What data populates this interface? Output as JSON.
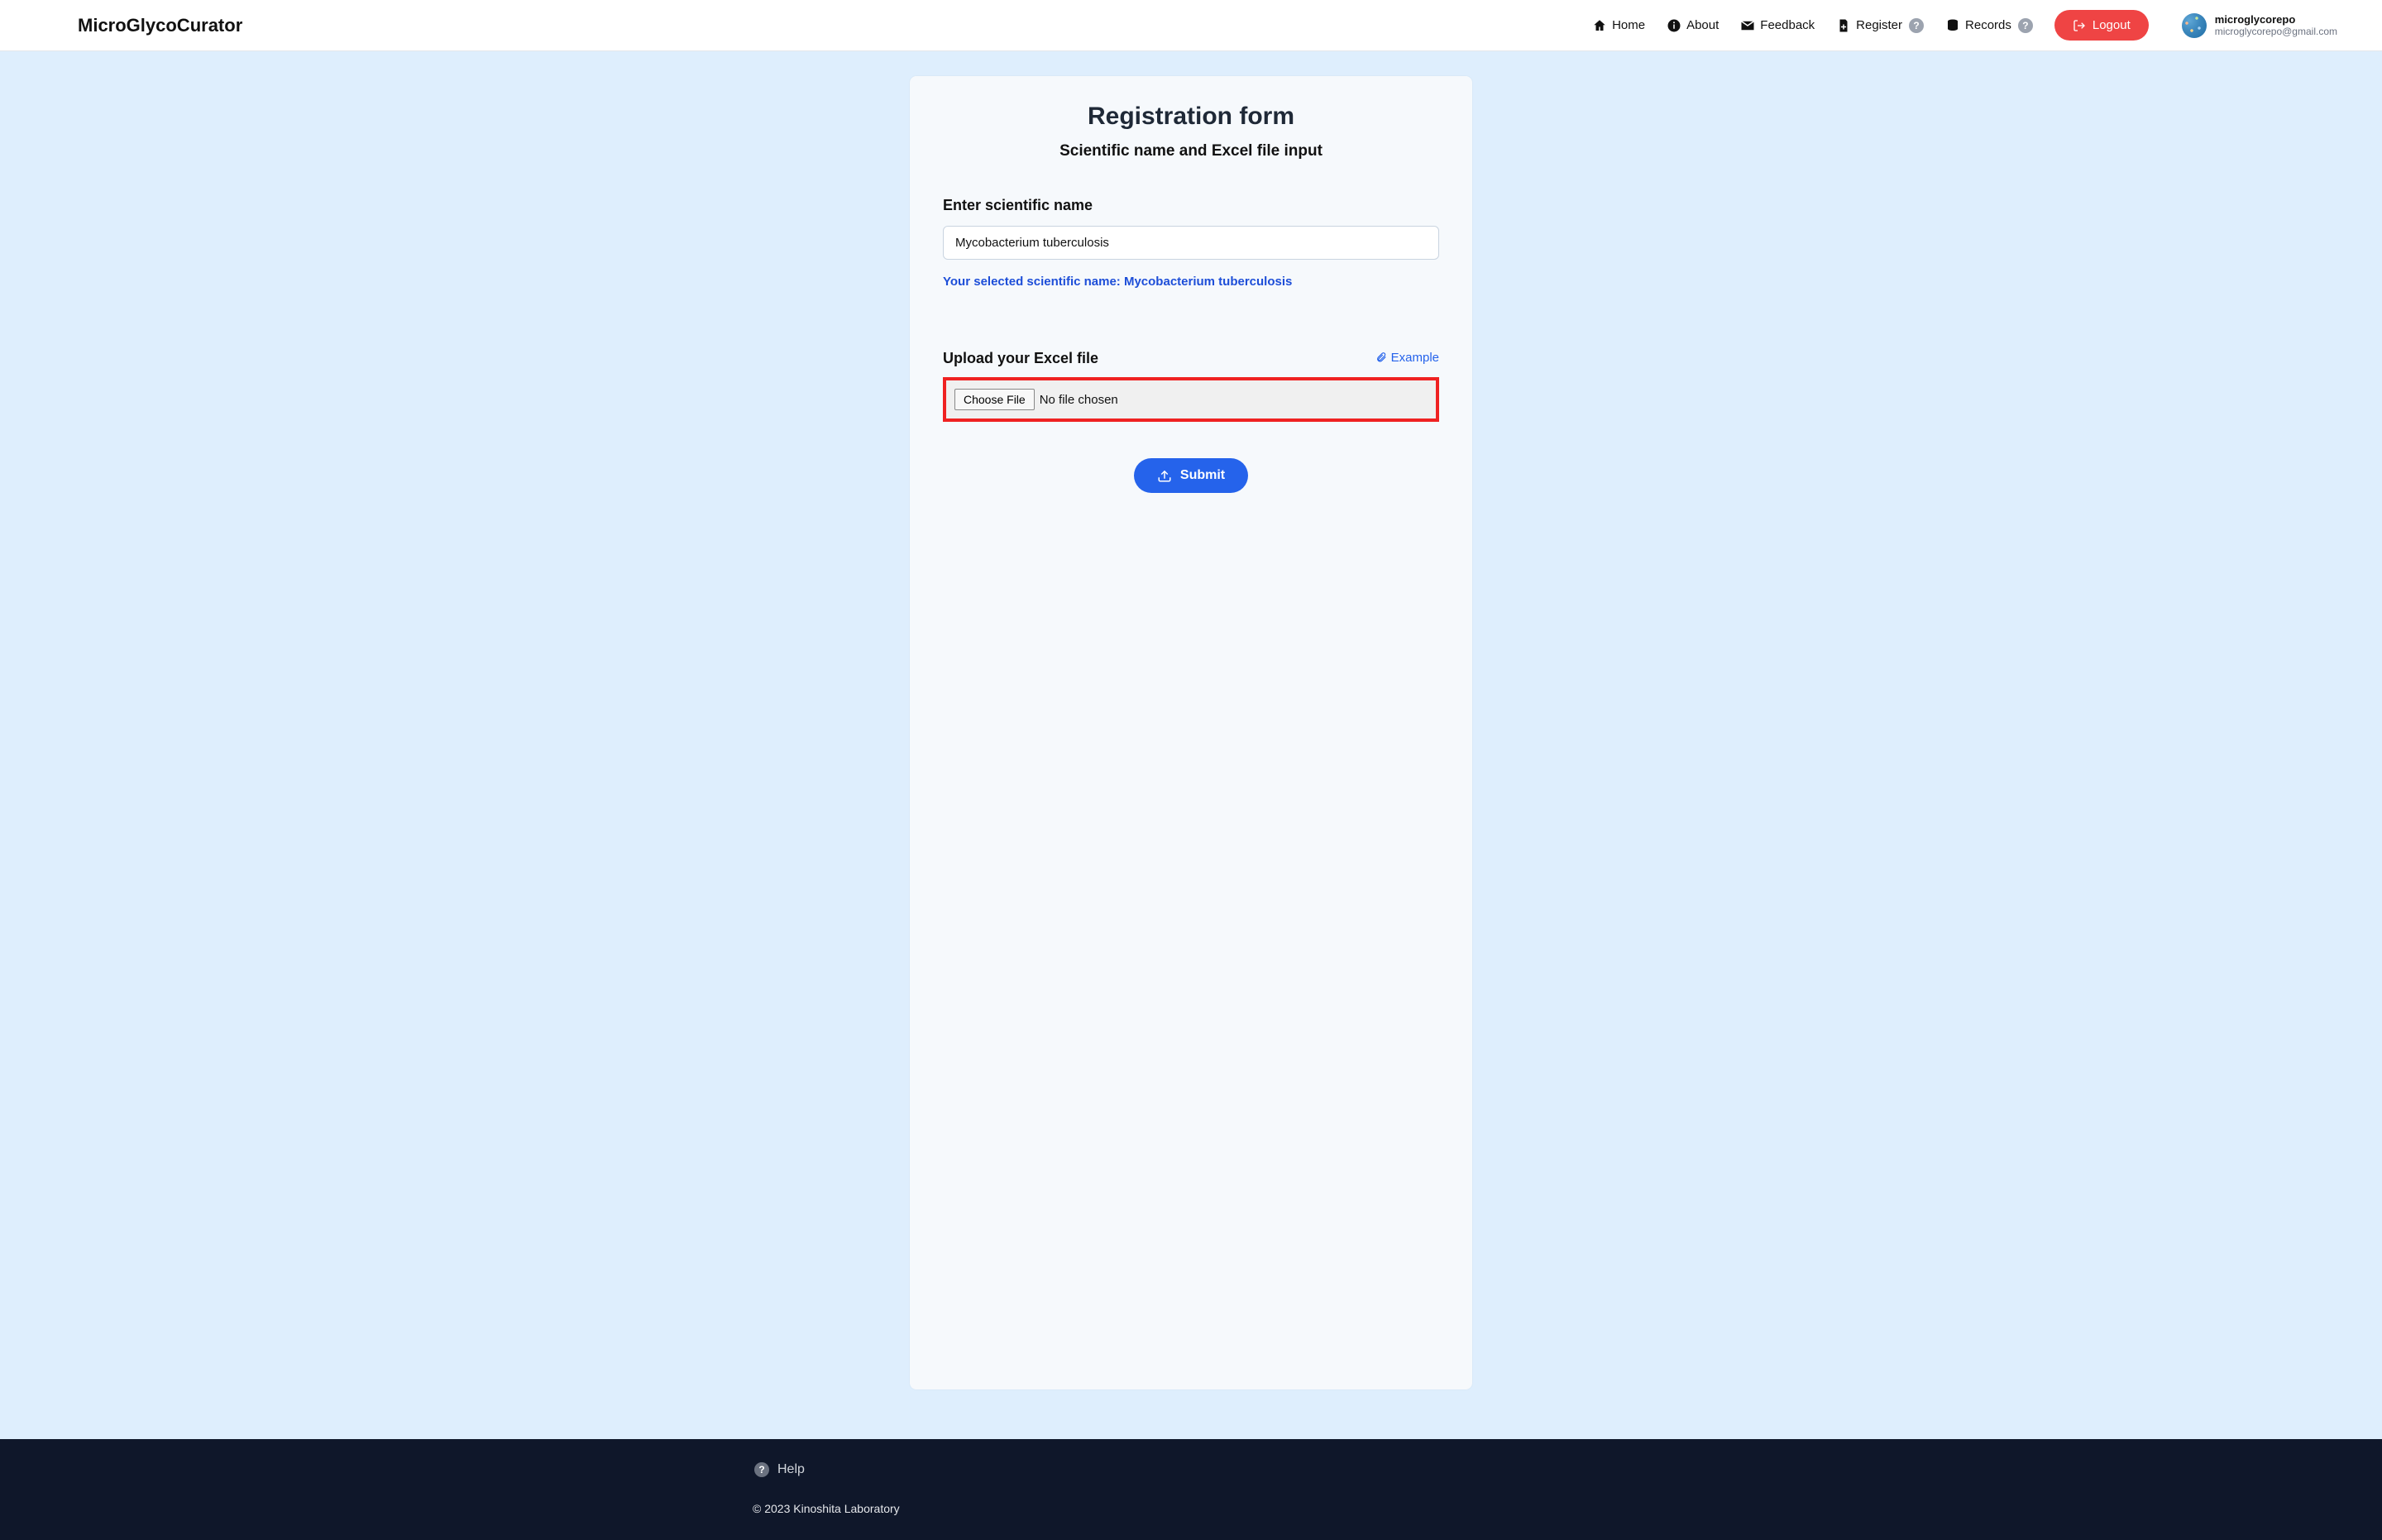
{
  "brand": "MicroGlycoCurator",
  "nav": {
    "home": "Home",
    "about": "About",
    "feedback": "Feedback",
    "register": "Register",
    "records": "Records",
    "logout": "Logout"
  },
  "help_glyph": "?",
  "user": {
    "name": "microglycorepo",
    "email": "microglycorepo@gmail.com"
  },
  "form": {
    "title": "Registration form",
    "subtitle": "Scientific name and Excel file input",
    "name_label": "Enter scientific name",
    "name_value": "Mycobacterium tuberculosis",
    "selected_prefix": "Your selected scientific name: ",
    "selected_name": "Mycobacterium tuberculosis",
    "upload_label": "Upload your Excel file",
    "example_link": "Example",
    "choose_file": "Choose File",
    "file_status": "No file chosen",
    "submit": "Submit"
  },
  "footer": {
    "help": "Help",
    "copyright": "© 2023 Kinoshita Laboratory"
  }
}
